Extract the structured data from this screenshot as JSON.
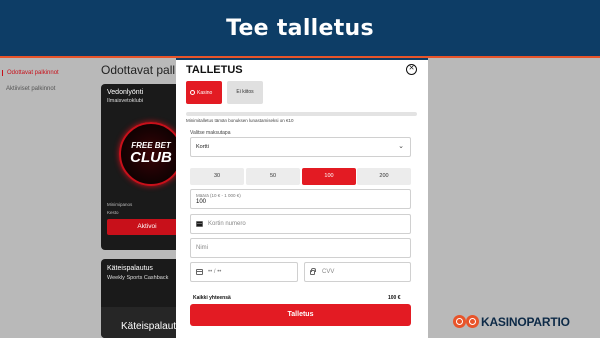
{
  "banner": {
    "title": "Tee talletus"
  },
  "background": {
    "sidebar": [
      "Odottavat palkinnot",
      "Aktiiviset palkinnot"
    ],
    "heading": "Odottavat pall",
    "card1": {
      "title": "Vedonlyönti",
      "subtitle": "Ilmaisvetoklubi",
      "logo_line1": "FREE BET",
      "logo_line2": "CLUB",
      "meta1": "Minimipanos",
      "meta2": "Kesto",
      "button": "Aktivoi"
    },
    "card2": {
      "title": "Käteispalautus",
      "subtitle": "Weekly Sports Cashback",
      "art_text": "Käteispalautu"
    }
  },
  "modal": {
    "title": "TALLETUS",
    "close_icon": "close-circle-icon",
    "methods": [
      {
        "label": "Kasino",
        "selected": true
      },
      {
        "label": "Ei kiitos",
        "selected": false
      }
    ],
    "note": "Minimitalletus tämän bonuksen lunastamiseksi on €10",
    "select_label": "Valitse maksutapa",
    "select_value": "Kortti",
    "amounts": [
      {
        "label": "30",
        "selected": false
      },
      {
        "label": "50",
        "selected": false
      },
      {
        "label": "100",
        "selected": true
      },
      {
        "label": "200",
        "selected": false
      }
    ],
    "amount_field": {
      "label": "Määrä (10 € - 1 000 €)",
      "value": "100"
    },
    "card_number_placeholder": "Kortin numero",
    "name_placeholder": "Nimi",
    "expiry_placeholder": "•• / ••",
    "cvv_placeholder": "CVV",
    "total_label": "Kaikki yhteensä",
    "total_value": "100 €",
    "submit": "Talletus"
  },
  "watermark": "KASINOPARTIO",
  "colors": {
    "brand_red": "#e31b23",
    "navy": "#0d3d66",
    "orange": "#e8542a"
  }
}
